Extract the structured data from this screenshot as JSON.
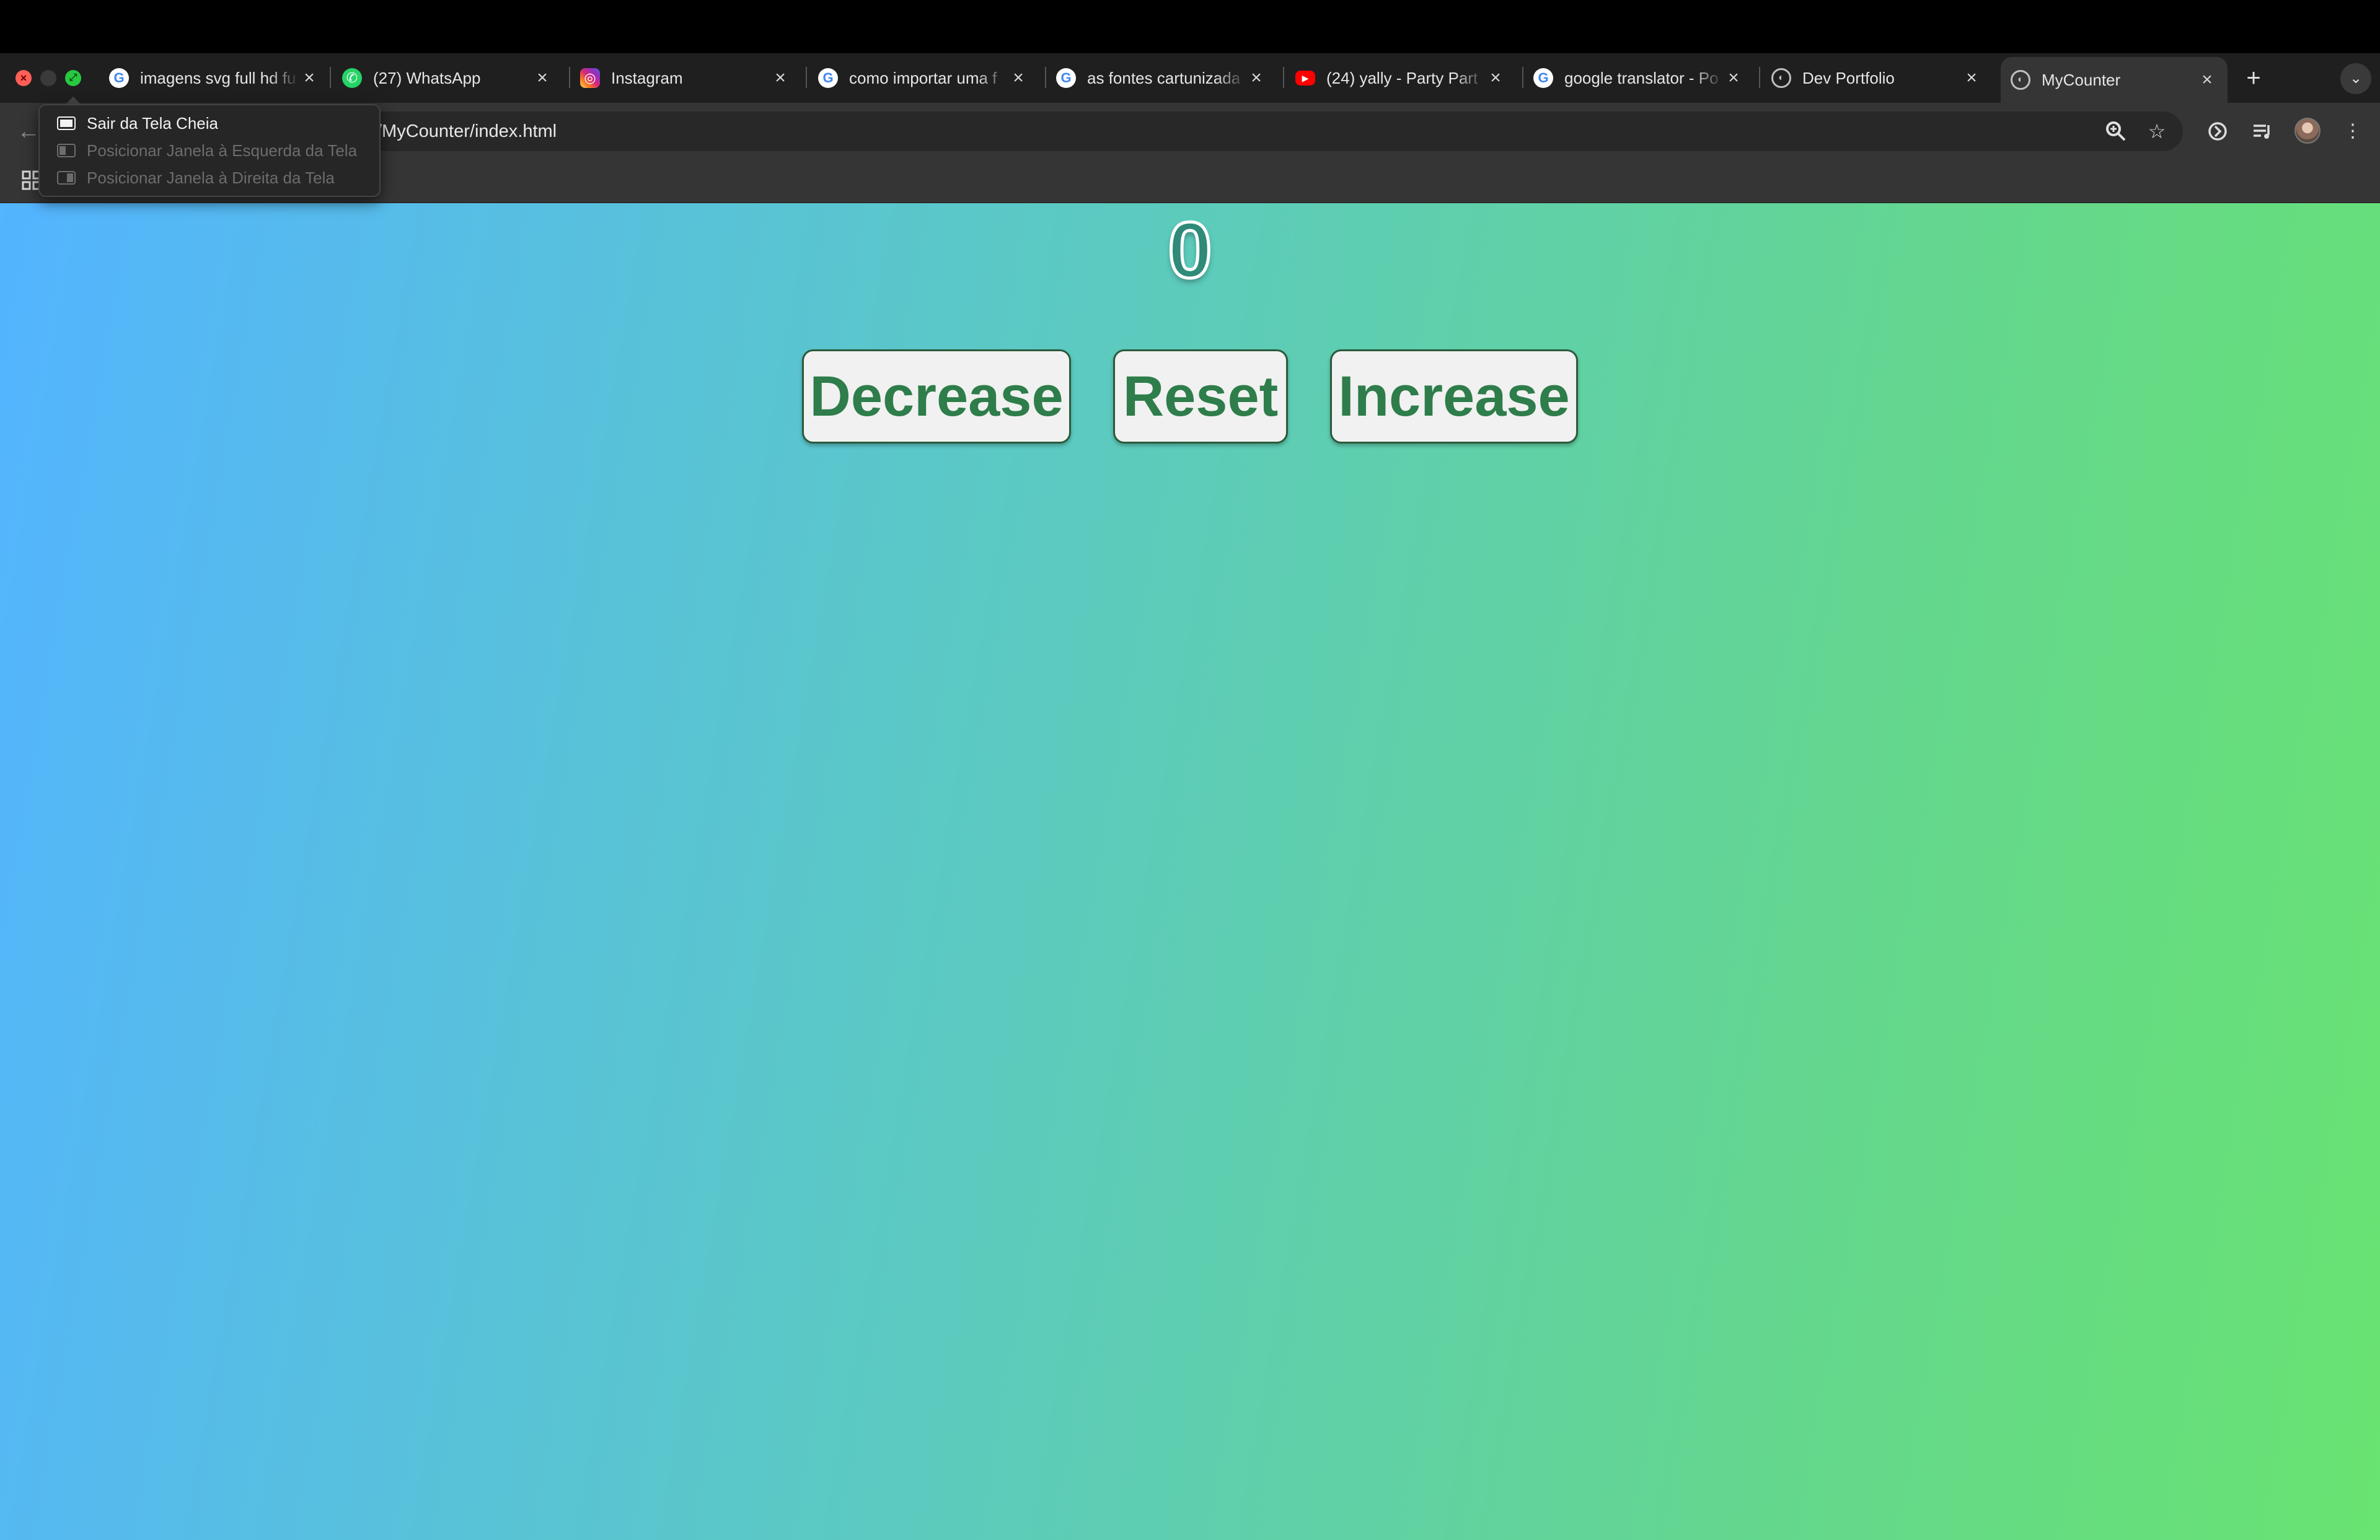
{
  "browser": {
    "tabs": [
      {
        "title": "imagens svg full hd fu",
        "favicon": "google-icon"
      },
      {
        "title": "(27) WhatsApp",
        "favicon": "whatsapp-icon"
      },
      {
        "title": "Instagram",
        "favicon": "instagram-icon"
      },
      {
        "title": "como importar uma f",
        "favicon": "google-icon"
      },
      {
        "title": "as fontes cartunizada",
        "favicon": "google-icon"
      },
      {
        "title": "(24) yally - Party Part",
        "favicon": "youtube-icon"
      },
      {
        "title": "google translator - Po",
        "favicon": "google-icon"
      },
      {
        "title": "Dev Portfolio",
        "favicon": "globe-icon"
      },
      {
        "title": "MyCounter",
        "favicon": "globe-icon",
        "active": true
      }
    ],
    "address_url": "/MyCounter/index.html",
    "fullscreen_menu": {
      "items": [
        {
          "label": "Sair da Tela Cheia",
          "enabled": true
        },
        {
          "label": "Posicionar Janela à Esquerda da Tela",
          "enabled": false
        },
        {
          "label": "Posicionar Janela à Direita da Tela",
          "enabled": false
        }
      ]
    },
    "icons": {
      "close": "×",
      "new_tab": "+",
      "tab_search": "⌄",
      "back": "←",
      "zoom": "zoom-icon",
      "bookmark": "star-icon",
      "menu": "⋮"
    }
  },
  "app": {
    "counter_value": "0",
    "buttons": {
      "decrease": "Decrease",
      "reset": "Reset",
      "increase": "Increase"
    },
    "colors": {
      "gradient_start": "#53b4ff",
      "gradient_end": "#69e371",
      "button_text": "#2e7d4a",
      "counter_fill": "#2f8a78"
    }
  }
}
